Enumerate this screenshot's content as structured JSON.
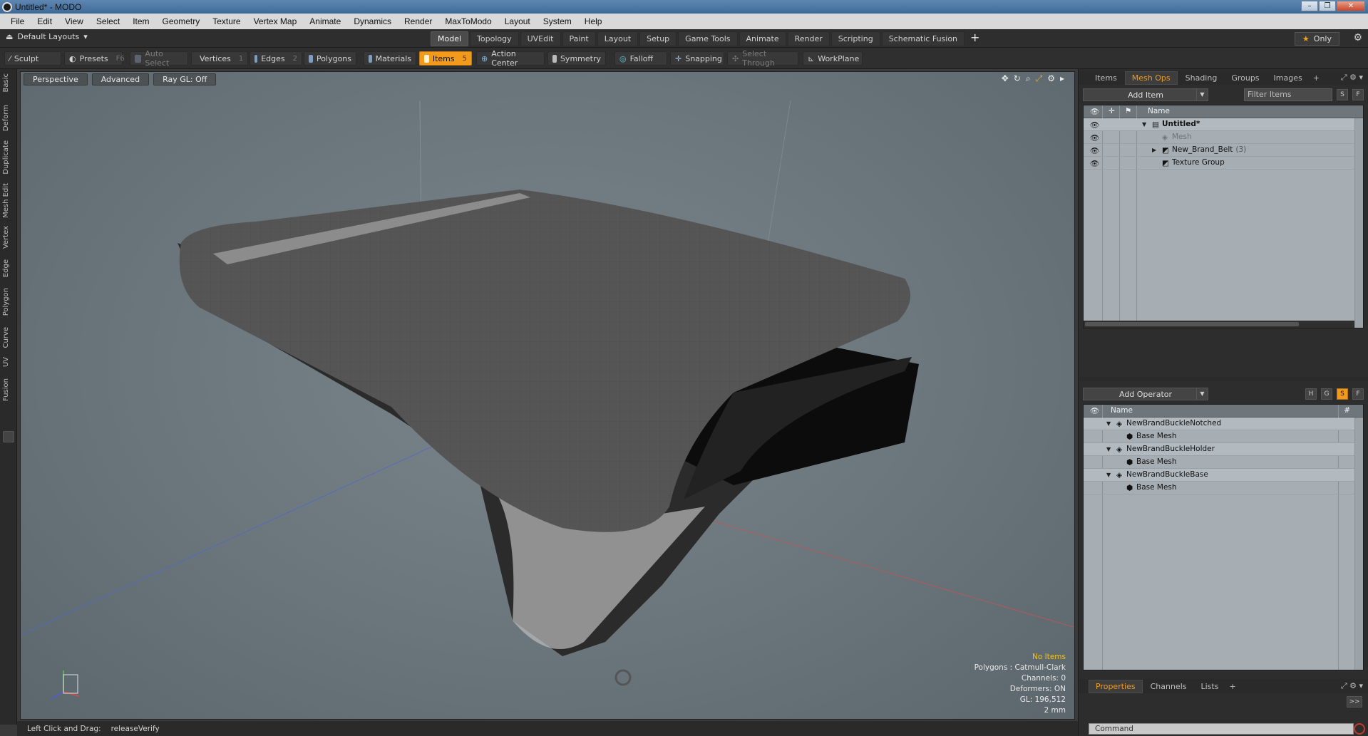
{
  "window": {
    "title": "Untitled* - MODO",
    "buttons": [
      "–",
      "❐",
      "✕"
    ]
  },
  "menubar": {
    "items": [
      "File",
      "Edit",
      "View",
      "Select",
      "Item",
      "Geometry",
      "Texture",
      "Vertex Map",
      "Animate",
      "Dynamics",
      "Render",
      "MaxToModo",
      "Layout",
      "System",
      "Help"
    ]
  },
  "layoutbar": {
    "layouts_label": "Default Layouts",
    "tabs": [
      "Model",
      "Topology",
      "UVEdit",
      "Paint",
      "Layout",
      "Setup",
      "Game Tools",
      "Animate",
      "Render",
      "Scripting",
      "Schematic Fusion"
    ],
    "active_tab": "Model",
    "add_tab": "+",
    "only_label": "Only"
  },
  "toolbar": {
    "sculpt": "Sculpt",
    "presets": "Presets",
    "presets_key": "F6",
    "auto_select": "Auto Select",
    "vertices": "Vertices",
    "vertices_key": "1",
    "edges": "Edges",
    "edges_key": "2",
    "polygons": "Polygons",
    "materials": "Materials",
    "items": "Items",
    "items_key": "5",
    "action_center": "Action Center",
    "symmetry": "Symmetry",
    "falloff": "Falloff",
    "snapping": "Snapping",
    "select_through": "Select Through",
    "workplane": "WorkPlane"
  },
  "lefttabs": [
    "Basic",
    "Deform",
    "Duplicate",
    "Mesh Edit",
    "Vertex",
    "Edge",
    "Polygon",
    "Curve",
    "UV",
    "Fusion"
  ],
  "viewport": {
    "perspective": "Perspective",
    "advanced": "Advanced",
    "raygl": "Ray GL: Off",
    "stats": {
      "no_items": "No Items",
      "polygons": "Polygons : Catmull-Clark",
      "channels": "Channels: 0",
      "deformers": "Deformers: ON",
      "gl": "GL: 196,512",
      "scale": "2 mm"
    }
  },
  "statusbar": {
    "hint": "Left Click and Drag:",
    "action": "releaseVerify"
  },
  "items_panel": {
    "tabs": [
      "Items",
      "Mesh Ops",
      "Shading",
      "Groups",
      "Images"
    ],
    "active_tab": "Mesh Ops",
    "add_item": "Add Item",
    "filter_placeholder": "Filter Items",
    "btn_s": "S",
    "btn_f": "F",
    "col_name": "Name",
    "rows": [
      {
        "label": "Untitled*",
        "bold": true
      },
      {
        "label": "Mesh",
        "dim": true
      },
      {
        "label": "New_Brand_Belt",
        "count": "(3)"
      },
      {
        "label": "Texture Group"
      }
    ]
  },
  "meshops_panel": {
    "add_operator": "Add Operator",
    "btn_h": "H",
    "btn_g": "G",
    "btn_s": "S",
    "btn_f": "F",
    "col_name": "Name",
    "col_hash": "#",
    "rows": [
      {
        "label": "NewBrandBuckleNotched",
        "level": 0
      },
      {
        "label": "Base Mesh",
        "level": 1
      },
      {
        "label": "NewBrandBuckleHolder",
        "level": 0
      },
      {
        "label": "Base Mesh",
        "level": 1
      },
      {
        "label": "NewBrandBuckleBase",
        "level": 0
      },
      {
        "label": "Base Mesh",
        "level": 1
      }
    ]
  },
  "properties_panel": {
    "tabs": [
      "Properties",
      "Channels",
      "Lists"
    ],
    "active_tab": "Properties",
    "expand": ">>",
    "command_placeholder": "Command"
  },
  "colors": {
    "accent": "#f29a1b",
    "panel_bg": "#2d2d2d",
    "tree_bg": "#a6adb3"
  }
}
